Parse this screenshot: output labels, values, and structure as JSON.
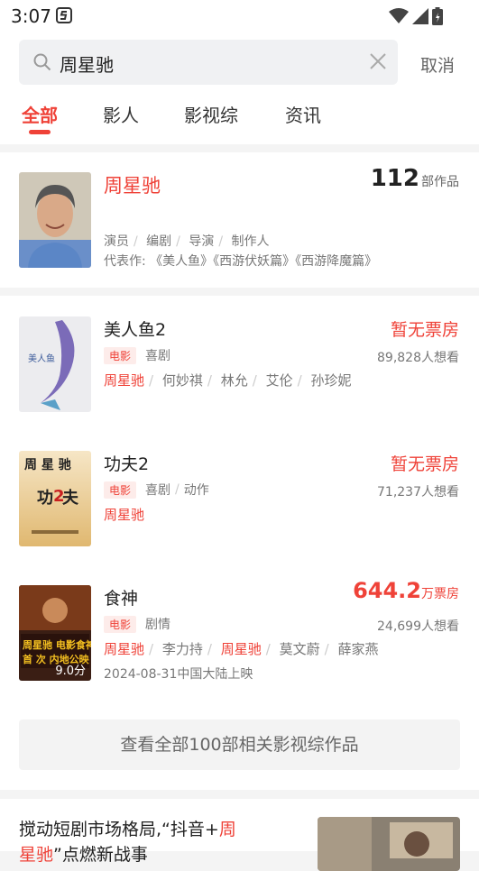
{
  "status_bar": {
    "time": "3:07"
  },
  "search": {
    "query": "周星驰",
    "cancel_label": "取消"
  },
  "tabs": [
    "全部",
    "影人",
    "影视综",
    "资讯"
  ],
  "celebrity": {
    "name": "周星驰",
    "works_count": "112",
    "works_unit": "部作品",
    "roles": [
      "演员",
      "编剧",
      "导演",
      "制作人"
    ],
    "representative_label": "代表作:",
    "representative_works": "《美人鱼》《西游伏妖篇》《西游降魔篇》"
  },
  "movies": [
    {
      "title": "美人鱼2",
      "box": "暂无票房",
      "tag": "电影",
      "genres": [
        "喜剧"
      ],
      "wants": "89,828人想看",
      "cast": [
        "周星驰",
        "何妙祺",
        "林允",
        "艾伦",
        "孙珍妮"
      ],
      "release": ""
    },
    {
      "title": "功夫2",
      "box": "暂无票房",
      "tag": "电影",
      "genres": [
        "喜剧",
        "动作"
      ],
      "wants": "71,237人想看",
      "cast": [
        "周星驰"
      ],
      "release": ""
    },
    {
      "title": "食神",
      "box_value": "644.2",
      "box_unit": "万票房",
      "tag": "电影",
      "genres": [
        "剧情"
      ],
      "wants": "24,699人想看",
      "cast": [
        "周星驰",
        "李力持",
        "周星驰",
        "莫文蔚",
        "薛家燕"
      ],
      "release": "2024-08-31中国大陆上映",
      "rating": "9.0分"
    }
  ],
  "more_button": "查看全部100部相关影视综作品",
  "news": {
    "title_part1": "搅动短剧市场格局,“抖音+",
    "title_hl1": "周",
    "title_hl2": "星驰",
    "title_part2": "”点燃新战事"
  },
  "colors": {
    "accent": "#ef4238",
    "text": "#222222",
    "muted": "#777777"
  }
}
